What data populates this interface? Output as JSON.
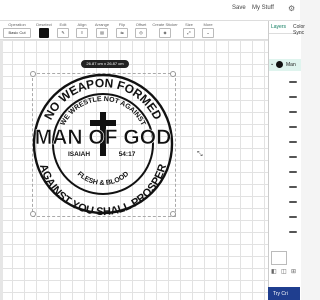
{
  "header": {
    "save": "Save",
    "my_stuff": "My Stuff",
    "settings_icon": "gear-icon"
  },
  "toolbar": {
    "items": [
      {
        "label": "Operation",
        "value": "Basic Cut"
      },
      {
        "label": "Deselect",
        "value": ""
      },
      {
        "label": "Edit",
        "value": ""
      },
      {
        "label": "Align",
        "value": ""
      },
      {
        "label": "Arrange",
        "value": ""
      },
      {
        "label": "Flip",
        "value": ""
      },
      {
        "label": "Offset",
        "value": ""
      },
      {
        "label": "Create Sticker",
        "value": ""
      },
      {
        "label": "Size",
        "value": ""
      },
      {
        "label": "More",
        "value": ""
      }
    ]
  },
  "panel": {
    "tabs": [
      "Layers",
      "Color Sync"
    ],
    "group_label": "Man",
    "try_button": "Try Cri"
  },
  "canvas": {
    "size_badge": "26.87 cm x 26.87 cm",
    "design": {
      "top_arc": "NO WEAPON FORMED",
      "inner_arc": "WE WRESTLE NOT AGAINST",
      "main": "MAN OF GOD",
      "ref_left": "ISAIAH",
      "ref_right": "54:17",
      "inner_bottom": "FLESH & BLOOD",
      "bottom_arc": "AGAINST YOU SHALL PROSPER"
    }
  }
}
